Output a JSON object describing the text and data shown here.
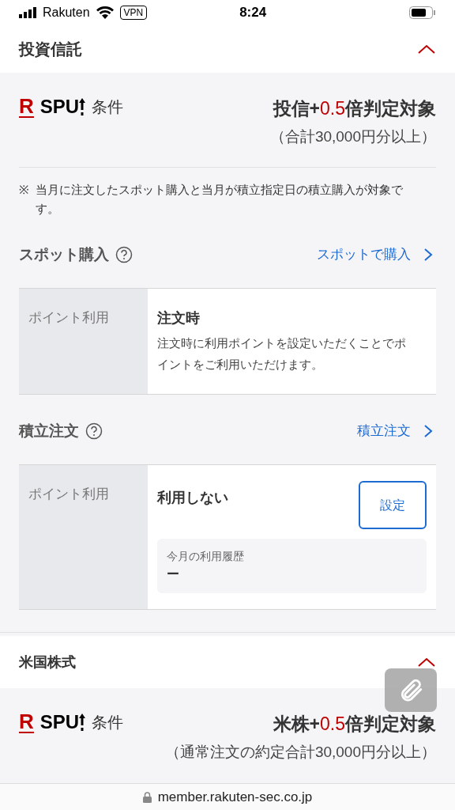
{
  "status_bar": {
    "carrier": "Rakuten",
    "vpn": "VPN",
    "time": "8:24"
  },
  "sections": [
    {
      "title": "投資信託",
      "expanded": true,
      "logo": {
        "mark": "R",
        "text": "SPU"
      },
      "condition_label": "条件",
      "headline": {
        "prefix": "投信+",
        "highlight": "0.5",
        "suffix": "倍判定対象"
      },
      "subline": "（合計30,000円分以上）",
      "note_mark": "※",
      "note": "当月に注文したスポット購入と当月が積立指定日の積立購入が対象です。",
      "groups": [
        {
          "title": "スポット購入",
          "link": "スポットで購入",
          "row_label": "ポイント利用",
          "value": "注文時",
          "description": "注文時に利用ポイントを設定いただくことでポイントをご利用いただけます。"
        },
        {
          "title": "積立注文",
          "link": "積立注文",
          "row_label": "ポイント利用",
          "value": "利用しない",
          "button": "設定",
          "history_label": "今月の利用履歴",
          "history_value": "ー"
        }
      ]
    },
    {
      "title": "米国株式",
      "expanded": true,
      "logo": {
        "mark": "R",
        "text": "SPU"
      },
      "condition_label": "条件",
      "headline": {
        "prefix": "米株+",
        "highlight": "0.5",
        "suffix": "倍判定対象"
      },
      "subline": "（通常注文の約定合計30,000円分以上）"
    }
  ],
  "url_bar": {
    "url": "member.rakuten-sec.co.jp"
  }
}
